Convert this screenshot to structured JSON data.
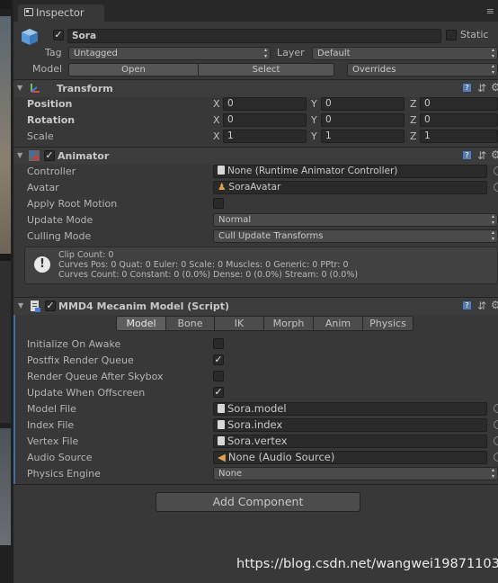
{
  "tab": {
    "title": "Inspector",
    "tools": "≡"
  },
  "object": {
    "name": "Sora",
    "static_label": "Static",
    "tag_label": "Tag",
    "tag_value": "Untagged",
    "layer_label": "Layer",
    "layer_value": "Default",
    "model_label": "Model",
    "open_btn": "Open",
    "select_btn": "Select",
    "overrides_value": "Overrides"
  },
  "transform": {
    "title": "Transform",
    "rows": [
      {
        "label": "Position",
        "x": "0",
        "y": "0",
        "z": "0"
      },
      {
        "label": "Rotation",
        "x": "0",
        "y": "0",
        "z": "0"
      },
      {
        "label": "Scale",
        "x": "1",
        "y": "1",
        "z": "1"
      }
    ],
    "axes": {
      "x": "X",
      "y": "Y",
      "z": "Z"
    }
  },
  "animator": {
    "title": "Animator",
    "controller_label": "Controller",
    "controller_value": "None (Runtime Animator Controller)",
    "avatar_label": "Avatar",
    "avatar_value": "SoraAvatar",
    "root_motion_label": "Apply Root Motion",
    "update_mode_label": "Update Mode",
    "update_mode_value": "Normal",
    "culling_label": "Culling Mode",
    "culling_value": "Cull Update Transforms",
    "info": [
      "Clip Count: 0",
      "Curves Pos: 0 Quat: 0 Euler: 0 Scale: 0 Muscles: 0 Generic: 0 PPtr: 0",
      "Curves Count: 0 Constant: 0 (0.0%) Dense: 0 (0.0%) Stream: 0 (0.0%)"
    ]
  },
  "mmd4": {
    "title": "MMD4 Mecanim Model (Script)",
    "tabs": [
      "Model",
      "Bone",
      "IK",
      "Morph",
      "Anim",
      "Physics"
    ],
    "init_label": "Initialize On Awake",
    "postfix_label": "Postfix Render Queue",
    "after_sky_label": "Render Queue After Skybox",
    "offscreen_label": "Update When Offscreen",
    "model_file_label": "Model File",
    "model_file_value": "Sora.model",
    "index_file_label": "Index File",
    "index_file_value": "Sora.index",
    "vertex_file_label": "Vertex File",
    "vertex_file_value": "Sora.vertex",
    "audio_label": "Audio Source",
    "audio_value": "None (Audio Source)",
    "physics_label": "Physics Engine",
    "physics_value": "None"
  },
  "add_component": "Add Component",
  "watermark": "https://blog.csdn.net/wangwei19871103"
}
